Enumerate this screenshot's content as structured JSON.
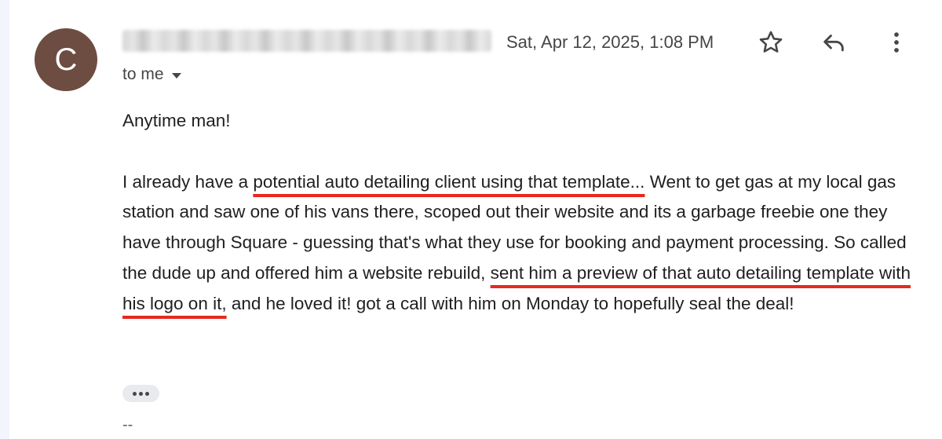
{
  "sender": {
    "avatar_initial": "C",
    "avatar_color": "#6d4c41",
    "name_redacted": true
  },
  "header": {
    "timestamp": "Sat, Apr 12, 2025, 1:08 PM",
    "to_label": "to me",
    "icons": [
      "star-icon",
      "reply-icon",
      "more-vert-icon"
    ]
  },
  "message": {
    "greeting": "Anytime man!",
    "para_pre1": "I already have a ",
    "para_hl1": "potential auto detailing client using that template...",
    "para_mid": " Went to get gas at my local gas station and saw one of his vans there, scoped out their website and its a garbage freebie one they have through Square - guessing that's what they use for booking and payment processing. So called the dude up and offered him a website rebuild, ",
    "para_hl2": "sent him a preview of that auto detailing template with his logo on it,",
    "para_post": " and he loved it! got a call with him on Monday to hopefully seal the deal!",
    "highlight_color": "#e8281e"
  },
  "trimmed_content": "•••",
  "signature_separator": "--"
}
